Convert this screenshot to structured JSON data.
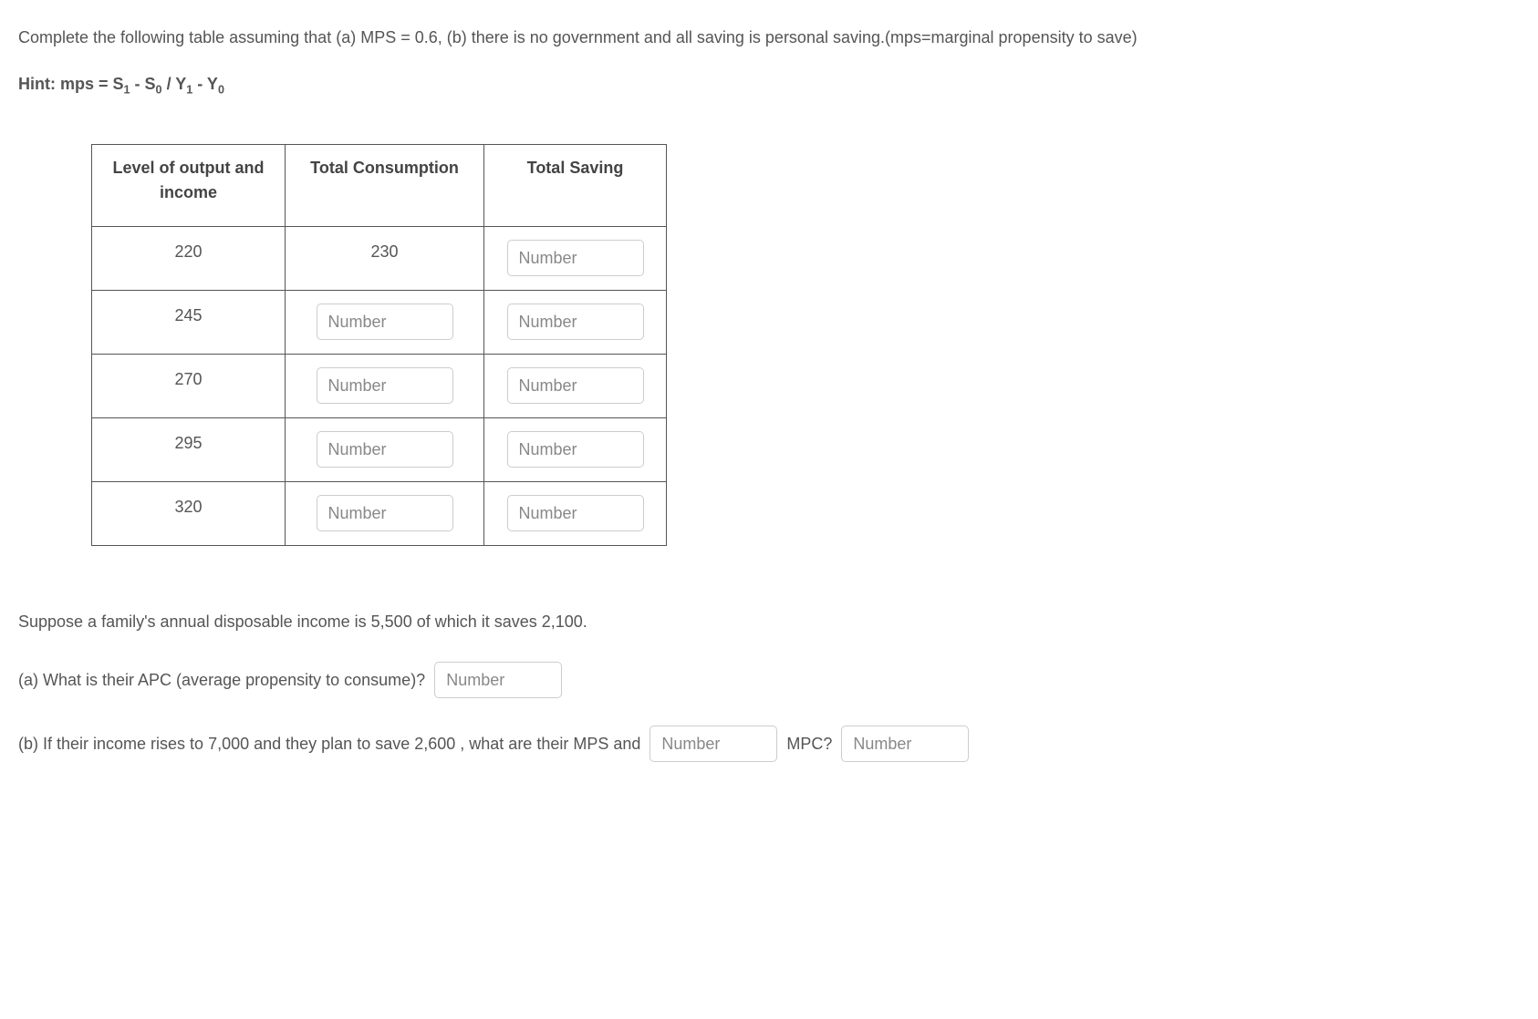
{
  "intro": "Complete the following table assuming that (a) MPS = 0.6, (b) there is no government and all saving is personal saving.(mps=marginal propensity to save)",
  "hint": {
    "prefix": "Hint:  mps = S",
    "sub1": "1",
    "mid1": " - S",
    "sub2": "0",
    "mid2": " / Y",
    "sub3": "1",
    "mid3": " - Y",
    "sub4": "0"
  },
  "table": {
    "headers": {
      "col1": "Level of output and income",
      "col2": "Total Consumption",
      "col3": "Total Saving"
    },
    "rows": [
      {
        "income": "220",
        "consumption": "230",
        "saving_input": true
      },
      {
        "income": "245",
        "consumption_input": true,
        "saving_input": true
      },
      {
        "income": "270",
        "consumption_input": true,
        "saving_input": true
      },
      {
        "income": "295",
        "consumption_input": true,
        "saving_input": true
      },
      {
        "income": "320",
        "consumption_input": true,
        "saving_input": true
      }
    ],
    "placeholder": "Number"
  },
  "q2": {
    "scenario": "Suppose a family's annual disposable income is  5,500 of which it saves  2,100.",
    "part_a": "(a) What is their APC (average propensity to consume)?",
    "part_b_pre": "(b) If their income rises to 7,000  and they plan to save 2,600 , what are their MPS and",
    "part_b_mpc": "MPC?",
    "placeholder": "Number"
  }
}
